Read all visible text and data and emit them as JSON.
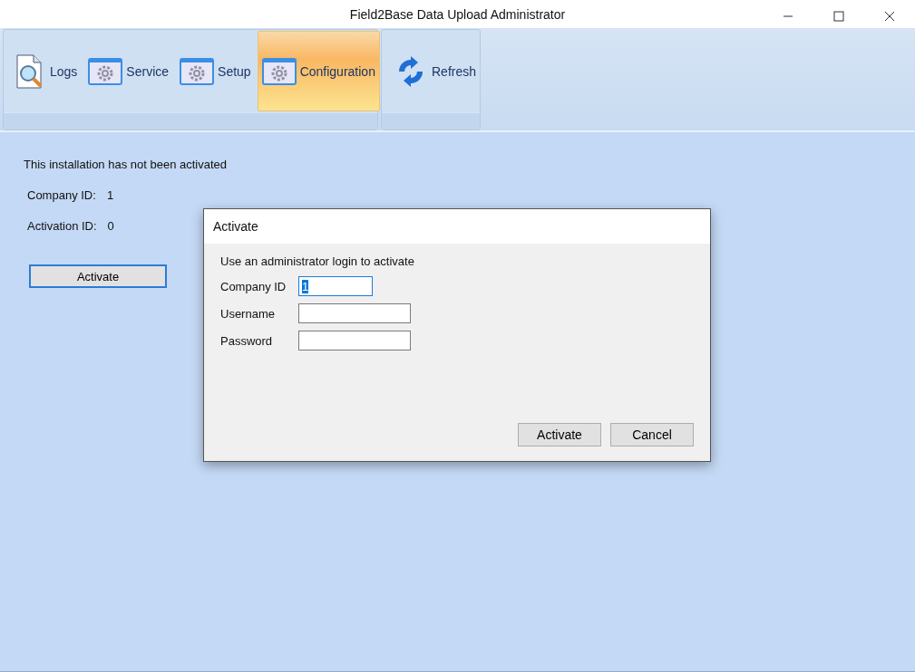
{
  "window": {
    "title": "Field2Base Data Upload Administrator"
  },
  "ribbon": {
    "groups": [
      {
        "items": [
          {
            "label": "Logs",
            "kind": "logs",
            "selected": false
          },
          {
            "label": "Service",
            "kind": "gear",
            "selected": false
          },
          {
            "label": "Setup",
            "kind": "gear",
            "selected": false
          },
          {
            "label": "Configuration",
            "kind": "gear",
            "selected": true
          }
        ]
      },
      {
        "items": [
          {
            "label": "Refresh",
            "kind": "refresh",
            "selected": false
          }
        ]
      }
    ]
  },
  "main": {
    "status": "This installation has not been activated",
    "info": [
      {
        "label": "Company ID:",
        "value": "1"
      },
      {
        "label": "Activation ID:",
        "value": "0"
      }
    ],
    "button": "Activate"
  },
  "dialog": {
    "title": "Activate",
    "instruction": "Use an administrator login to activate",
    "fields": [
      {
        "label": "Company ID",
        "value": "1",
        "focused": true
      },
      {
        "label": "Username",
        "focused": false
      },
      {
        "label": "Password",
        "focused": false
      }
    ],
    "buttons": [
      "Activate",
      "Cancel"
    ]
  }
}
